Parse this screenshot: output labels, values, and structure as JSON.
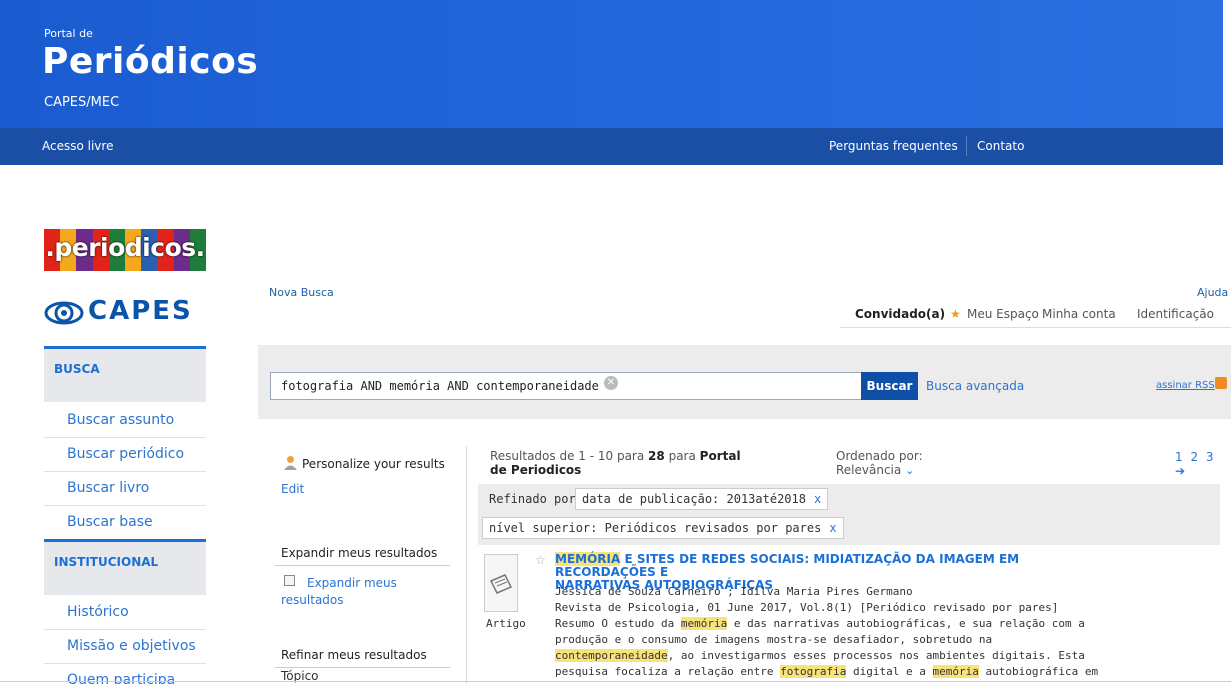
{
  "header": {
    "portal_small": "Portal de",
    "portal_big": "Periódicos",
    "portal_sub": "CAPES/MEC",
    "acesso": "Acesso livre",
    "faq": "Perguntas frequentes",
    "contato": "Contato",
    "colors": {
      "banner": "#2368db",
      "navbar": "#1b4fa6"
    }
  },
  "logos": {
    "periodicos": ".periodicos.",
    "capes": "CAPES"
  },
  "sidebar": {
    "busca_title": "BUSCA",
    "busca_items": [
      "Buscar assunto",
      "Buscar periódico",
      "Buscar livro",
      "Buscar base"
    ],
    "inst_title": "INSTITUCIONAL",
    "inst_items": [
      "Histórico",
      "Missão e objetivos",
      "Quem participa"
    ]
  },
  "topbar": {
    "nova_busca": "Nova Busca",
    "ajuda": "Ajuda",
    "guest": "Convidado(a)",
    "meu_espaco": "Meu Espaço",
    "minha_conta": "Minha conta",
    "identificacao": "Identificação"
  },
  "search": {
    "query": "fotografia AND memória AND contemporaneidade",
    "button": "Buscar",
    "advanced": "Busca avançada",
    "rss": "assinar RSS"
  },
  "filters": {
    "personalize": "Personalize your results",
    "edit": "Edit",
    "expand_title": "Expandir meus resultados",
    "expand_label_1": "Expandir meus",
    "expand_label_2": "resultados",
    "refine_title": "Refinar meus resultados",
    "topico": "Tópico"
  },
  "results": {
    "count_prefix": "Resultados de 1 - 10 para",
    "total": "28",
    "count_mid": "para",
    "count_source_1": "Portal",
    "count_source_2": "de Periodicos",
    "order_label": "Ordenado por:",
    "order_value": "Relevância",
    "pages": "1 2 3 ➔",
    "refined_label": "Refinado por:",
    "chips": [
      "data de publicação: 2013até2018",
      "nível superior: Periódicos revisados por pares"
    ],
    "item": {
      "type": "Artigo",
      "title_hl": "MEMÓRIA",
      "title_rest_1": " E SITES DE REDES SOCIAIS: MIDIATIZAÇÃO DA IMAGEM EM RECORDAÇÕES E",
      "title_rest_2": "NARRATIVAS AUTOBIOGRÁFICAS",
      "authors": "Jéssica de Souza Carneiro ; Idilva Maria Pires Germano",
      "source": "Revista de Psicologia, 01 June 2017, Vol.8(1) [Periódico revisado por pares]",
      "abs1_a": "Resumo O estudo da ",
      "abs1_hl": "memória",
      "abs1_b": " e das narrativas autobiográficas, e sua relação com a",
      "abs2": "produção e o consumo de imagens mostra-se desafiador, sobretudo na",
      "abs3_hl": "contemporaneidade",
      "abs3_b": ", ao investigarmos esses processos nos ambientes digitais. Esta",
      "abs4_a": "pesquisa focaliza a relação entre ",
      "abs4_hl1": "fotografia",
      "abs4_b": " digital e a ",
      "abs4_hl2": "memória",
      "abs4_c": " autobiográfica em"
    }
  }
}
